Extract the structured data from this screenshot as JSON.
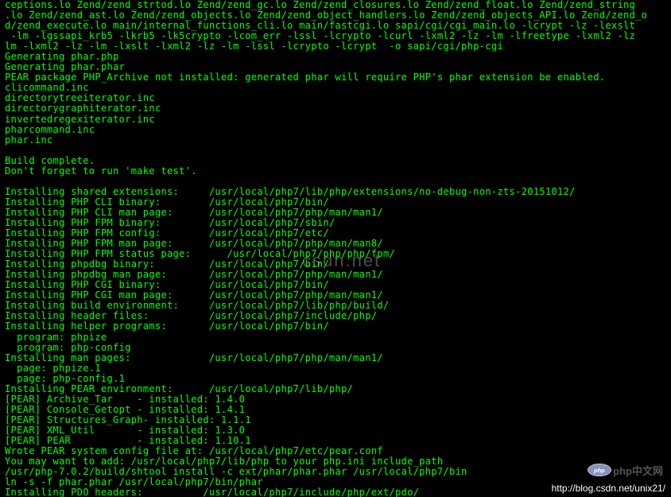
{
  "terminal": {
    "lines": [
      "ceptions.lo Zend/zend_strtod.lo Zend/zend_gc.lo Zend/zend_closures.lo Zend/zend_float.lo Zend/zend_string",
      ".lo Zend/zend_ast.lo Zend/zend_objects.lo Zend/zend_object_handlers.lo Zend/zend_objects_API.lo Zend/zend_o",
      "d/zend_execute.lo main/internal_functions_cli.lo main/fastcgi.lo sapi/cgi/cgi_main.lo -lcrypt -lz -lexslt",
      " -lm -lgssapi_krb5 -lkrb5 -lk5crypto -lcom_err -lssl -lcrypto -lcurl -lxml2 -lz -lm -lfreetype -lxml2 -lz",
      "lm -lxml2 -lz -lm -lxslt -lxml2 -lz -lm -lssl -lcrypto -lcrypt  -o sapi/cgi/php-cgi",
      "Generating phar.php",
      "Generating phar.phar",
      "PEAR package PHP_Archive not installed: generated phar will require PHP's phar extension be enabled.",
      "clicommand.inc",
      "directorytreeiterator.inc",
      "directorygraphiterator.inc",
      "invertedregexiterator.inc",
      "pharcommand.inc",
      "phar.inc",
      "",
      "Build complete.",
      "Don't forget to run 'make test'.",
      "",
      "Installing shared extensions:     /usr/local/php7/lib/php/extensions/no-debug-non-zts-20151012/",
      "Installing PHP CLI binary:        /usr/local/php7/bin/",
      "Installing PHP CLI man page:      /usr/local/php7/php/man/man1/",
      "Installing PHP FPM binary:        /usr/local/php7/sbin/",
      "Installing PHP FPM config:        /usr/local/php7/etc/",
      "Installing PHP FPM man page:      /usr/local/php7/php/man/man8/",
      "Installing PHP FPM status page:      /usr/local/php7/php/php/fpm/",
      "Installing phpdbg binary:         /usr/local/php7/bin/",
      "Installing phpdbg man page:       /usr/local/php7/php/man/man1/",
      "Installing PHP CGI binary:        /usr/local/php7/bin/",
      "Installing PHP CGI man page:      /usr/local/php7/php/man/man1/",
      "Installing build environment:     /usr/local/php7/lib/php/build/",
      "Installing header files:          /usr/local/php7/include/php/",
      "Installing helper programs:       /usr/local/php7/bin/",
      "  program: phpize",
      "  program: php-config",
      "Installing man pages:             /usr/local/php7/php/man/man1/",
      "  page: phpize.1",
      "  page: php-config.1",
      "Installing PEAR environment:      /usr/local/php7/lib/php/",
      "[PEAR] Archive_Tar    - installed: 1.4.0",
      "[PEAR] Console_Getopt - installed: 1.4.1",
      "[PEAR] Structures_Graph- installed: 1.1.1",
      "[PEAR] XML_Util       - installed: 1.3.0",
      "[PEAR] PEAR           - installed: 1.10.1",
      "Wrote PEAR system config file at: /usr/local/php7/etc/pear.conf",
      "You may want to add: /usr/local/php7/lib/php to your php.ini include_path",
      "/usr/php-7.0.2/build/shtool install -c ext/phar/phar.phar /usr/local/php7/bin",
      "ln -s -f phar.phar /usr/local/php7/bin/phar",
      "Installing PDO headers:          /usr/local/php7/include/php/ext/pdo/"
    ]
  },
  "watermark": {
    "center": "csdn.net"
  },
  "logo": {
    "text": "php中文网"
  },
  "source_url": "http://blog.csdn.net/unix21/"
}
